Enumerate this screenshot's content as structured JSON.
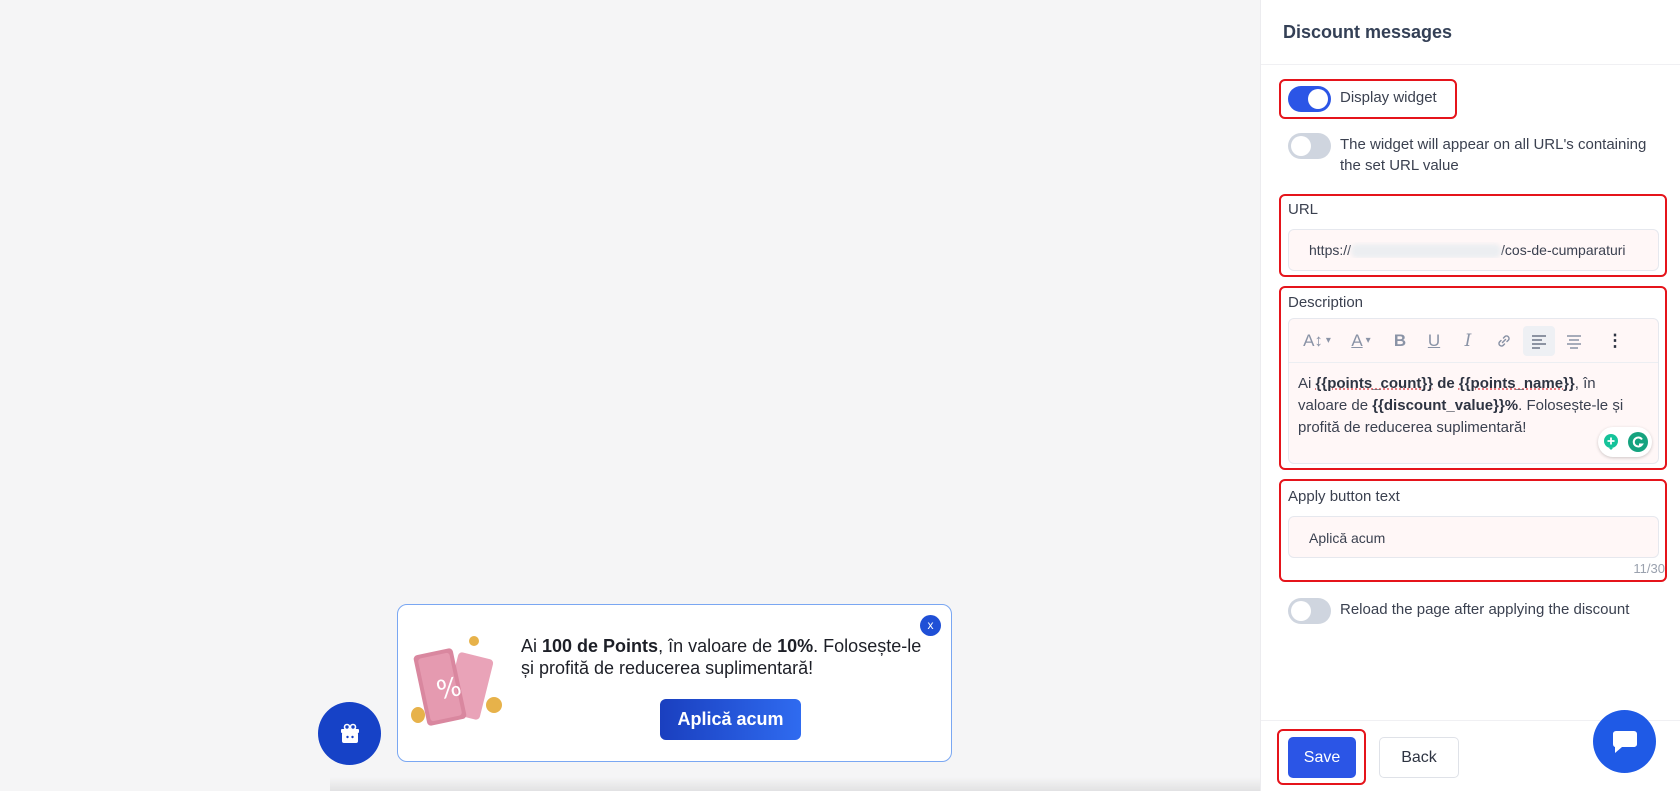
{
  "panel": {
    "title": "Discount messages",
    "display_widget_label": "Display widget",
    "url_match_label": "The widget will appear on all URL's containing the set URL value",
    "url_label": "URL",
    "url_value_prefix": "https://",
    "url_value_suffix": "/cos-de-cumparaturi",
    "description_label": "Description",
    "description": {
      "p1": "Ai ",
      "v1": "{{points_count}}",
      "p2": " de ",
      "v2": "{{points_name}}",
      "p3": ", în valoare de ",
      "v3": "{{discount_value}}%",
      "p4": ". Folosește-le și profită de reducerea suplimentară!"
    },
    "apply_label": "Apply button text",
    "apply_value": "Aplică acum",
    "apply_counter": "11/30",
    "reload_label": "Reload the page after applying the discount",
    "save_label": "Save",
    "back_label": "Back"
  },
  "toggles": {
    "display_widget": true,
    "url_match": false,
    "reload": false
  },
  "widget": {
    "close_label": "x",
    "t1": "Ai ",
    "b1": "100 de Points",
    "t2": ", în valoare de ",
    "b2": "10%",
    "t3": ". Folosește-le și profită de reducerea suplimentară!",
    "apply_label": "Aplică acum"
  },
  "icons": {
    "widget_fab": "gift-icon",
    "chat": "chat-icon"
  },
  "colors": {
    "accent": "#2b55e6",
    "highlight": "#e5141b",
    "widget_border": "#7aa7f2"
  }
}
